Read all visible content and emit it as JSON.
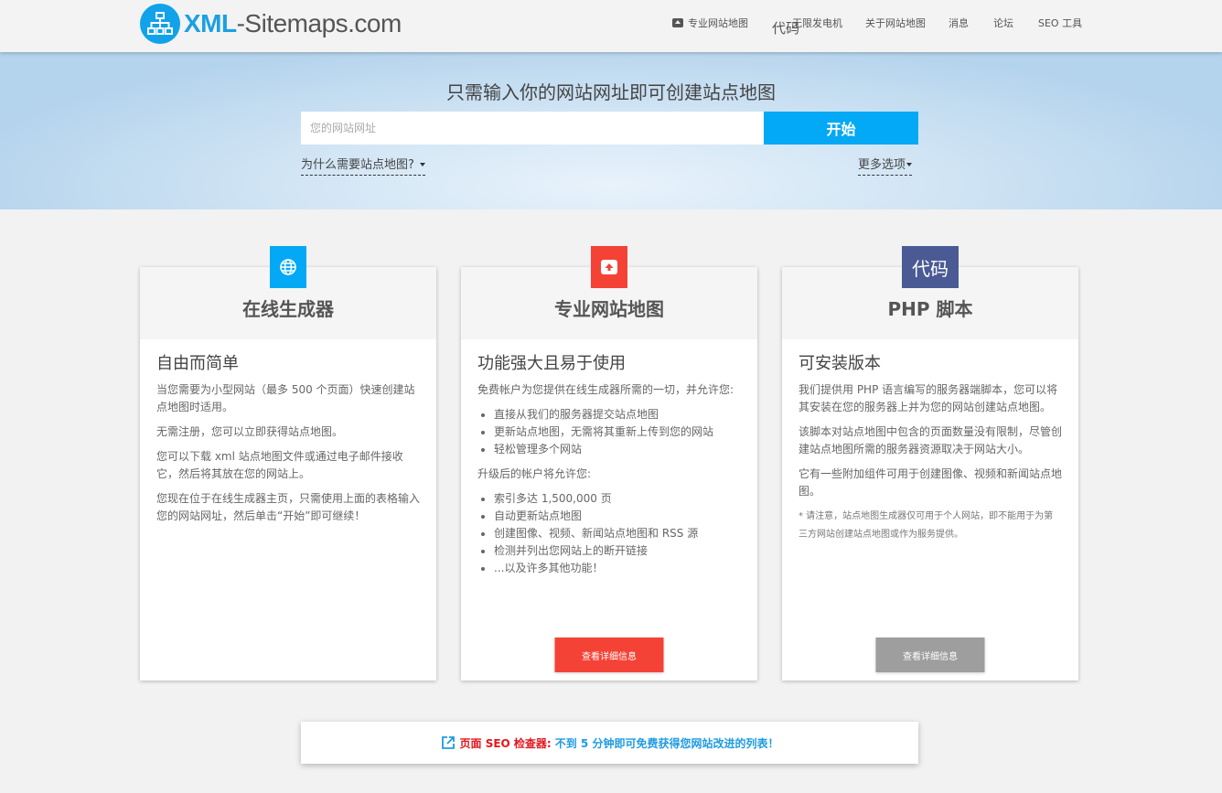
{
  "header": {
    "logo": {
      "part1": "XML",
      "part2": "-Sitemaps.com"
    },
    "nav": [
      {
        "label": "专业网站地图",
        "icon": "cloud-upload-icon"
      },
      {
        "label": "无限发电机"
      },
      {
        "label": "关于网站地图"
      },
      {
        "label": "消息"
      },
      {
        "label": "论坛"
      },
      {
        "label": "SEO 工具"
      }
    ],
    "code_glyph": "代码"
  },
  "hero": {
    "title": "只需输入你的网站网址即可创建站点地图",
    "input_placeholder": "您的网站网址",
    "start_button": "开始",
    "why_link": "为什么需要站点地图?",
    "more_options": "更多选项"
  },
  "cards": [
    {
      "icon": "globe-icon",
      "icon_color": "#03a9f4",
      "title": "在线生成器",
      "subtitle": "自由而简单",
      "paragraphs": [
        "当您需要为小型网站（最多 500 个页面）快速创建站点地图时适用。",
        "无需注册，您可以立即获得站点地图。",
        "您可以下载 xml 站点地图文件或通过电子邮件接收它，然后将其放在您的网站上。",
        "您现在位于在线生成器主页，只需使用上面的表格输入您的网站网址，然后单击“开始”即可继续！"
      ]
    },
    {
      "icon": "cloud-upload-icon",
      "icon_color": "#f44336",
      "title": "专业网站地图",
      "subtitle": "功能强大且易于使用",
      "intro": "免费帐户为您提供在线生成器所需的一切，并允许您:",
      "list1": [
        "直接从我们的服务器提交站点地图",
        "更新站点地图，无需将其重新上传到您的网站",
        "轻松管理多个网站"
      ],
      "intro2": "升级后的帐户将允许您:",
      "list2": [
        "索引多达 1,500,000 页",
        "自动更新站点地图",
        "创建图像、视频、新闻站点地图和 RSS 源",
        "检测并列出您网站上的断开链接",
        "...以及许多其他功能！"
      ],
      "button": "查看详细信息",
      "button_color": "#f44336"
    },
    {
      "icon": "code-icon",
      "icon_text": "代码",
      "icon_color": "#4a5a94",
      "title": "PHP 脚本",
      "subtitle": "可安装版本",
      "paragraphs": [
        "我们提供用 PHP 语言编写的服务器端脚本，您可以将其安装在您的服务器上并为您的网站创建站点地图。",
        "该脚本对站点地图中包含的页面数量没有限制，尽管创建站点地图所需的服务器资源取决于网站大小。",
        "它有一些附加组件可用于创建图像、视频和新闻站点地图。"
      ],
      "note": "* 请注意，站点地图生成器仅可用于个人网站，即不能用于为第三方网站创建站点地图或作为服务提供。",
      "button": "查看详细信息",
      "button_color": "#9e9e9e"
    }
  ],
  "banner": {
    "icon": "external-link-icon",
    "red_text": "页面 SEO 检查器:",
    "blue_text": "不到 5 分钟即可免费获得您网站改进的列表！"
  }
}
